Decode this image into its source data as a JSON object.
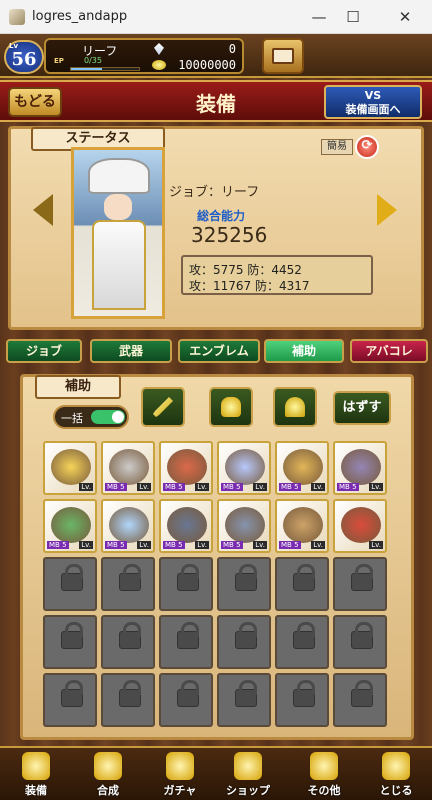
{
  "window": {
    "title": "logres_andapp",
    "minimize": "—",
    "maximize": "☐",
    "close": "✕"
  },
  "player": {
    "level_tag": "Lv",
    "level": "56",
    "name": "リーフ",
    "ep_label": "EP",
    "ep_value": "0/35",
    "exp_fraction": 0.45,
    "gems": "0",
    "gold": "10000000"
  },
  "header": {
    "back": "もどる",
    "title": "装備",
    "vs": "VS",
    "vs_sub": "装備画面へ"
  },
  "status": {
    "tab": "ステータス",
    "simple": "簡易",
    "job": "ジョブ：リーフ",
    "power_label": "総合能力",
    "power": "325256",
    "row1": "攻：5775 防：4452",
    "row2": "攻：11767 防：4317"
  },
  "tabs": [
    "ジョブ",
    "武器",
    "エンブレム",
    "補助",
    "アバコレ"
  ],
  "inventory": {
    "tab": "補助",
    "all_label": "一括",
    "remove": "はずす",
    "row1": [
      {
        "lv": "Lv.",
        "mb": ""
      },
      {
        "lv": "Lv.",
        "mb": "MB 5"
      },
      {
        "lv": "Lv.",
        "mb": "MB 5"
      },
      {
        "lv": "Lv.",
        "mb": "MB 5"
      },
      {
        "lv": "Lv.",
        "mb": "MB 5"
      },
      {
        "lv": "Lv.",
        "mb": "MB 5"
      }
    ],
    "row2": [
      {
        "lv": "Lv.",
        "mb": "MB 5"
      },
      {
        "lv": "Lv.",
        "mb": "MB 5"
      },
      {
        "lv": "Lv.",
        "mb": "MB 5"
      },
      {
        "lv": "Lv.",
        "mb": "MB 5"
      },
      {
        "lv": "Lv.",
        "mb": "MB 5"
      },
      {
        "lv": "Lv.",
        "mb": ""
      }
    ]
  },
  "bottom_nav": [
    "装備",
    "合成",
    "ガチャ",
    "ショップ",
    "その他",
    "とじる"
  ]
}
